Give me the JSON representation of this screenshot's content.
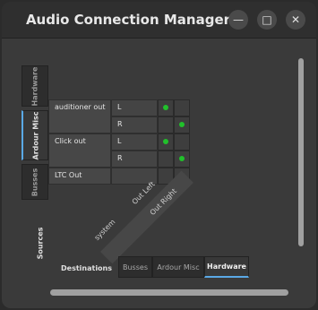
{
  "window": {
    "title": "Audio Connection Manager"
  },
  "sources_tabs": [
    "Hardware",
    "Ardour Misc",
    "Busses"
  ],
  "sources_label": "Sources",
  "ports": [
    {
      "name": "auditioner out",
      "channels": [
        "L",
        "R"
      ]
    },
    {
      "name": "Click out",
      "channels": [
        "L",
        "R"
      ]
    },
    {
      "name": "LTC Out",
      "channels": [
        ""
      ]
    }
  ],
  "dest_group": "system",
  "dest_ports": [
    "Out Left",
    "Out Right"
  ],
  "destinations_label": "Destinations",
  "destination_tabs": [
    "Busses",
    "Ardour Misc",
    "Hardware"
  ],
  "connections": [
    [
      1,
      0
    ],
    [
      0,
      1
    ],
    [
      1,
      0
    ],
    [
      0,
      1
    ],
    [
      0,
      0
    ]
  ]
}
